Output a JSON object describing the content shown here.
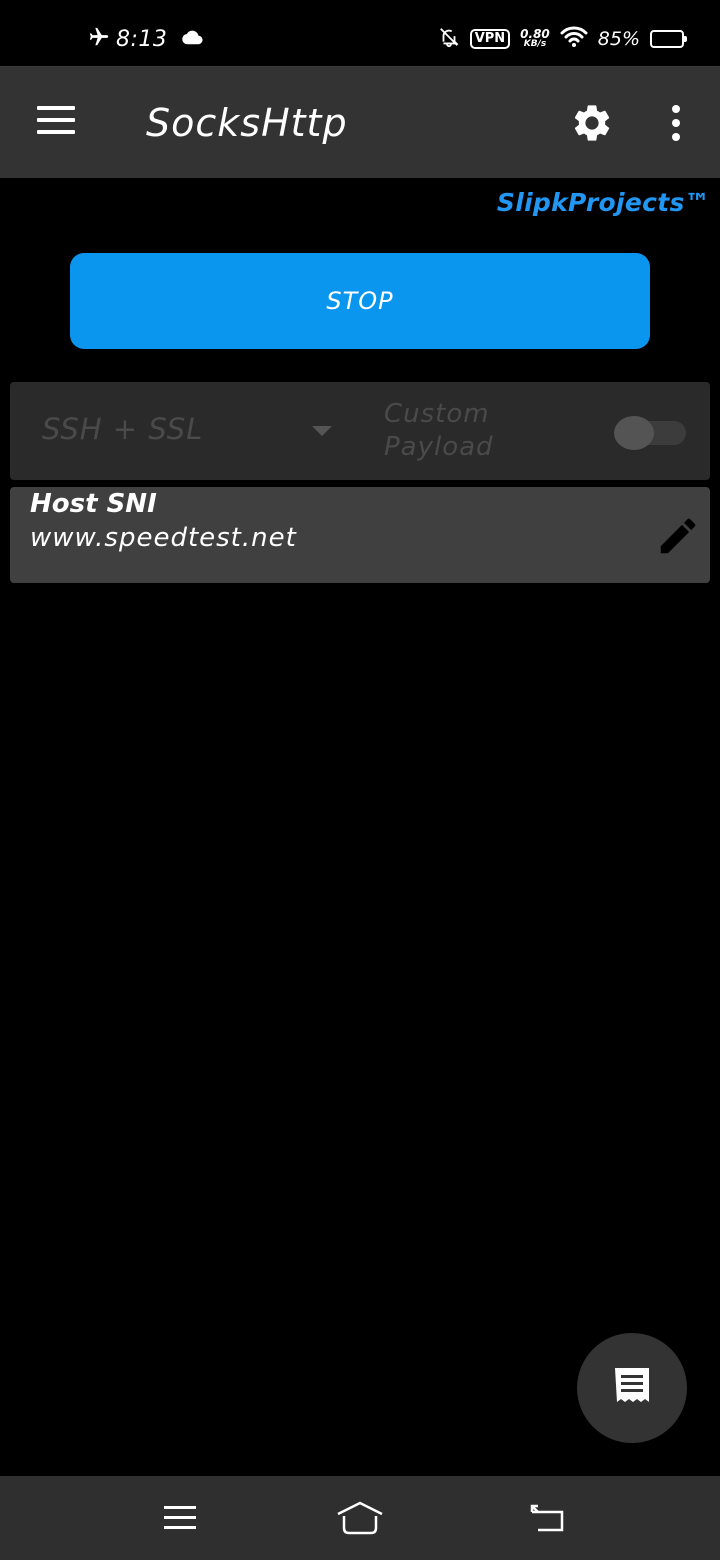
{
  "status_bar": {
    "time": "8:13",
    "vpn_label": "VPN",
    "net_speed": "0.80",
    "net_speed_unit": "KB/s",
    "battery_percent": "85%",
    "battery_level": 0.85,
    "icons": [
      "airplane-icon",
      "cloud-icon",
      "bell-off-icon",
      "vpn-icon",
      "wifi-icon",
      "battery-icon"
    ]
  },
  "app_bar": {
    "title": "SocksHttp",
    "icons": [
      "menu-icon",
      "gear-icon",
      "more-vert-icon"
    ]
  },
  "brand": "SlipkProjects™",
  "main": {
    "stop_label": "STOP",
    "mode": {
      "selected": "SSH + SSL",
      "payload_label_line1": "Custom",
      "payload_label_line2": "Payload",
      "payload_enabled": false
    },
    "host": {
      "label": "Host SNI",
      "value": "www.speedtest.net",
      "edit_icon": "pencil-icon"
    },
    "fab_icon": "log-icon"
  },
  "nav_bar": {
    "icons": [
      "recents-icon",
      "home-icon",
      "back-icon"
    ]
  },
  "colors": {
    "accent": "#0a96ee",
    "brand": "#2196f3",
    "app_bar": "#333333",
    "background": "#000000",
    "card": "#404040"
  }
}
